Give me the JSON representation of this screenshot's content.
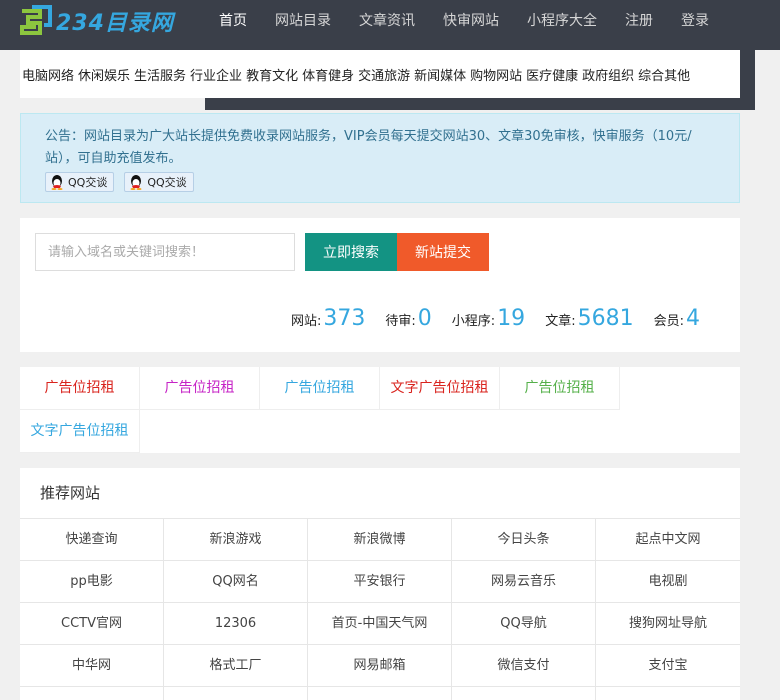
{
  "header": {
    "logo_text": "234目录网",
    "nav": [
      "首页",
      "网站目录",
      "文章资讯",
      "快审网站",
      "小程序大全",
      "注册",
      "登录"
    ],
    "active_nav": "首页"
  },
  "categories": [
    "电脑网络",
    "休闲娱乐",
    "生活服务",
    "行业企业",
    "教育文化",
    "体育健身",
    "交通旅游",
    "新闻媒体",
    "购物网站",
    "医疗健康",
    "政府组织",
    "综合其他"
  ],
  "notice": {
    "text": "公告：网站目录为广大站长提供免费收录网站服务，VIP会员每天提交网站30、文章30免审核，快审服务（10元/站），可自助充值发布。",
    "qq_buttons": [
      "QQ交谈",
      "QQ交谈"
    ]
  },
  "search": {
    "placeholder": "请输入域名或关键词搜索！",
    "value": "",
    "search_button": "立即搜索",
    "submit_button": "新站提交"
  },
  "stats": [
    {
      "label": "网站",
      "value": "373"
    },
    {
      "label": "待审",
      "value": "0"
    },
    {
      "label": "小程序",
      "value": "19"
    },
    {
      "label": "文章",
      "value": "5681"
    },
    {
      "label": "会员",
      "value": "4"
    }
  ],
  "ads": [
    {
      "text": "广告位招租",
      "color": "#d9231d"
    },
    {
      "text": "广告位招租",
      "color": "#c623c6"
    },
    {
      "text": "广告位招租",
      "color": "#35a7df"
    },
    {
      "text": "文字广告位招租",
      "color": "#d9231d"
    },
    {
      "text": "广告位招租",
      "color": "#55b04a"
    },
    {
      "text": "文字广告位招租",
      "color": "#35a7df"
    }
  ],
  "recommended": {
    "title": "推荐网站",
    "sites": [
      "快递查询",
      "新浪游戏",
      "新浪微博",
      "今日头条",
      "起点中文网",
      "pp电影",
      "QQ网名",
      "平安银行",
      "网易云音乐",
      "电视剧",
      "CCTV官网",
      "12306",
      "首页-中国天气网",
      "QQ导航",
      "搜狗网址导航",
      "中华网",
      "格式工厂",
      "网易邮箱",
      "微信支付",
      "支付宝",
      "",
      "",
      "",
      "",
      ""
    ]
  },
  "colors": {
    "header_bg": "#3a3f49",
    "accent": "#35a7df",
    "search_button": "#139383",
    "submit_button": "#f05a2a",
    "notice_bg": "#d9edf7",
    "notice_text": "#31708f"
  }
}
